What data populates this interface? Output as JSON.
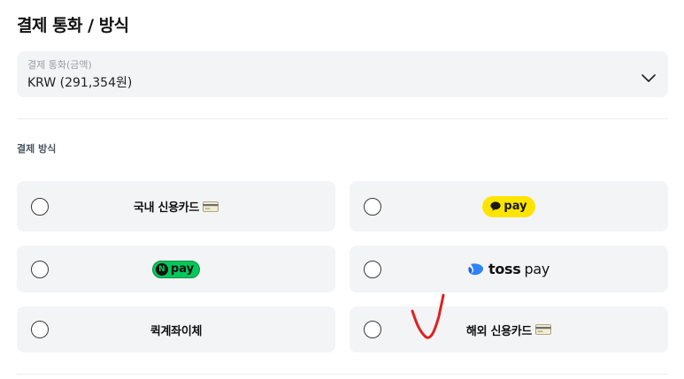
{
  "page_title": "결제 통화 / 방식",
  "currency": {
    "label": "결제 통화(금액)",
    "value": "KRW (291,354원)"
  },
  "payment_section_label": "결제 방식",
  "options": {
    "domestic_card": "국내 신용카드",
    "kakao_pay": "pay",
    "naver_pay": "pay",
    "naver_n": "N",
    "toss_pay_brand": "toss",
    "toss_pay_suffix": "pay",
    "quick_transfer": "퀵계좌이체",
    "overseas_card": "해외 신용카드"
  },
  "colors": {
    "kakao_yellow": "#fee500",
    "naver_green": "#03c75a",
    "toss_blue": "#3182f6",
    "annotation_red": "#e02020"
  }
}
